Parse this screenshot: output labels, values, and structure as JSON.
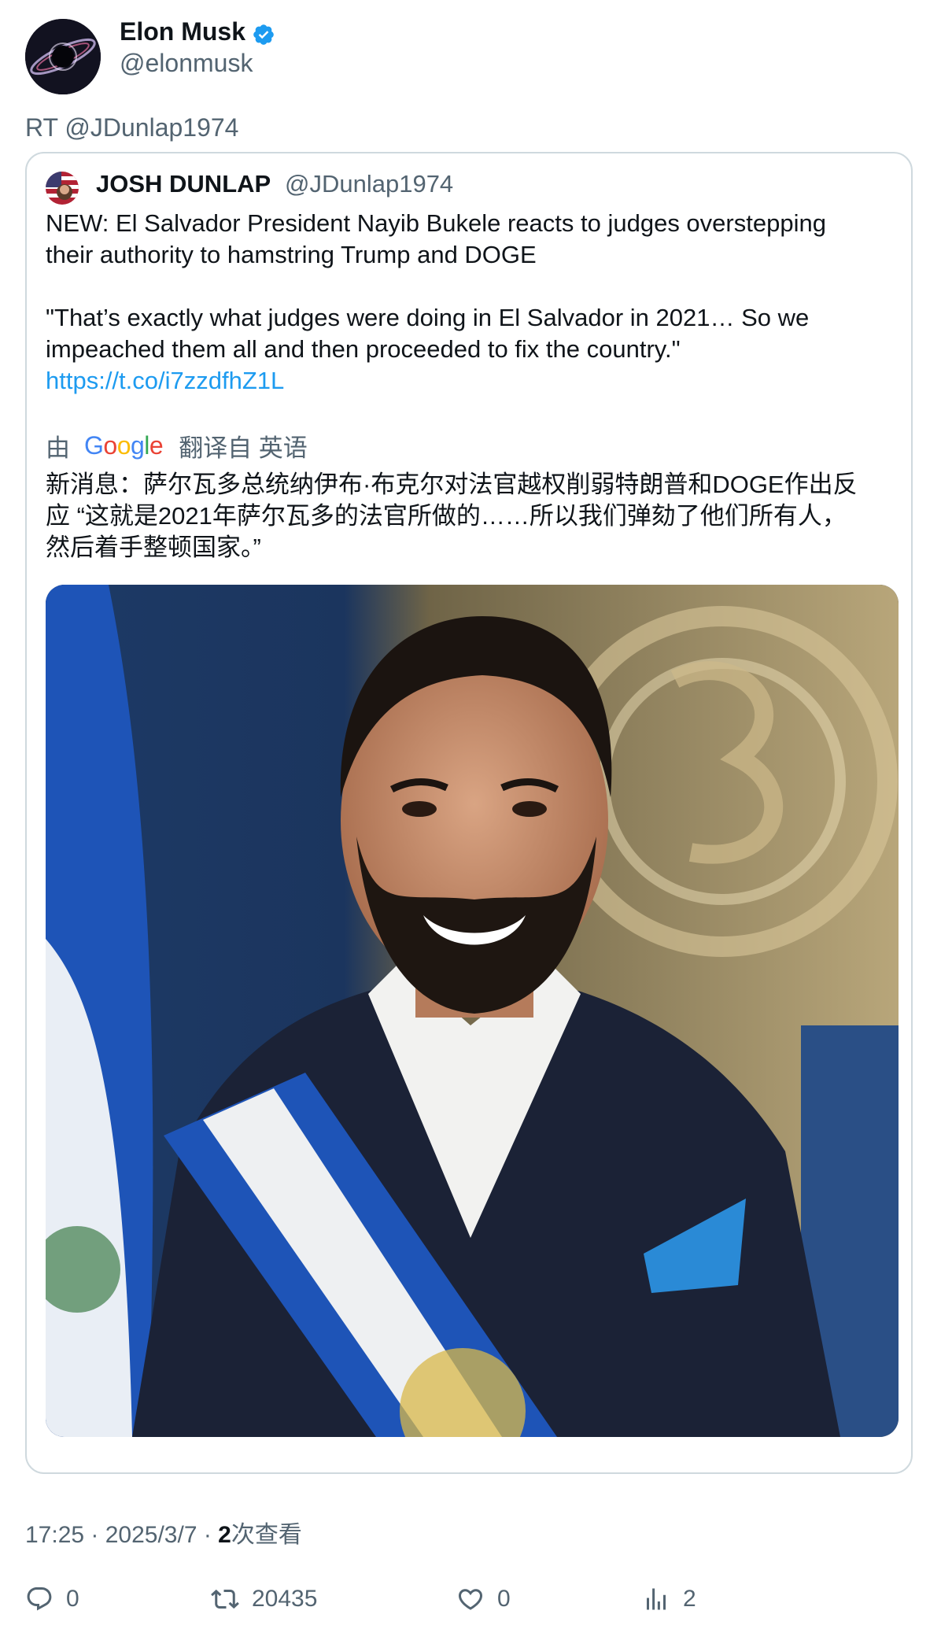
{
  "author": {
    "name": "Elon Musk",
    "handle": "@elonmusk"
  },
  "retweet_line": "RT @JDunlap1974",
  "quote": {
    "name": "JOSH DUNLAP",
    "handle": "@JDunlap1974",
    "line1": "NEW: El Salvador President Nayib Bukele reacts to judges overstepping",
    "line2": "their authority to hamstring Trump and DOGE",
    "line3": "\"That’s exactly what judges were doing in El Salvador in 2021… So we",
    "line4": "impeached them all and then proceeded to fix the country.\"",
    "link": "https://t.co/i7zzdfhZ1L"
  },
  "translation": {
    "by": "由",
    "provider_letters": [
      "G",
      "o",
      "o",
      "g",
      "l",
      "e"
    ],
    "from": "翻译自 英语",
    "text_line1": "新消息：萨尔瓦多总统纳伊布·布克尔对法官越权削弱特朗普和DOGE作出反",
    "text_line2": "应 “这就是2021年萨尔瓦多的法官所做的……所以我们弹劾了他们所有人，",
    "text_line3": "然后着手整顿国家。”"
  },
  "meta": {
    "time_date": "17:25 · 2025/3/7 · ",
    "views_count": "2",
    "views_label": "次查看"
  },
  "actions": {
    "replies": "0",
    "retweets": "20435",
    "likes": "0",
    "views": "2"
  },
  "colors": {
    "link": "#1d9bf0",
    "secondary_text": "#536471",
    "verified": "#1d9bf0",
    "card_border": "#cfd9de",
    "google": [
      "#4285f4",
      "#ea4335",
      "#fbbc05",
      "#4285f4",
      "#34a853",
      "#ea4335"
    ]
  },
  "icons": [
    "verified-badge-icon",
    "reply-icon",
    "retweet-icon",
    "like-icon",
    "views-icon"
  ]
}
